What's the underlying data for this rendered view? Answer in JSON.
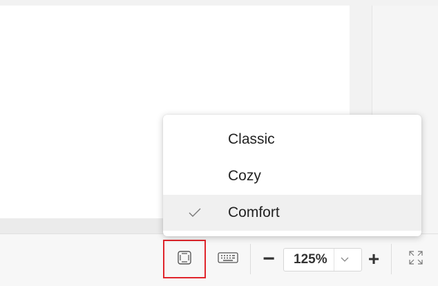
{
  "menu": {
    "items": [
      {
        "label": "Classic",
        "selected": false
      },
      {
        "label": "Cozy",
        "selected": false
      },
      {
        "label": "Comfort",
        "selected": true
      }
    ]
  },
  "status_bar": {
    "view_mode_icon": "view-mode-icon",
    "keyboard_icon": "keyboard-icon",
    "zoom_out_label": "−",
    "zoom_value": "125%",
    "zoom_in_label": "+",
    "fullscreen_icon": "fullscreen-icon"
  },
  "colors": {
    "highlight_border": "#e0242b",
    "selected_item_bg": "#f0f0f0"
  }
}
